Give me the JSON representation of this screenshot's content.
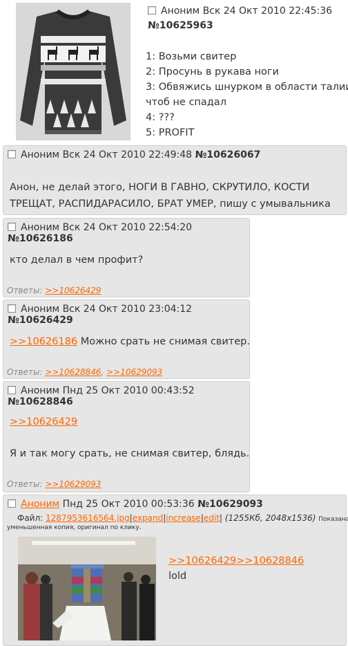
{
  "op": {
    "author": "Аноним",
    "date": "Вск 24 Окт 2010 22:45:36",
    "number": "№10625963",
    "lines": [
      "1: Возьми свитер",
      "2: Просунь в рукава ноги",
      "3: Обвяжись шнурком в области талии",
      "чтоб не спадал",
      "4: ???",
      "5: PROFIT"
    ]
  },
  "posts": [
    {
      "author": "Аноним",
      "date": "Вск 24 Окт 2010 22:49:48",
      "number": "№10626067",
      "text_line1": "Анон, не делай этого, НОГИ В ГАВНО, СКРУТИЛО, КОСТИ",
      "text_line2": "ТРЕЩАТ, РАСПИДАРАСИЛО, БРАТ УМЕР, пишу с умывальника"
    },
    {
      "author": "Аноним",
      "date": "Вск 24 Окт 2010 22:54:20",
      "number": "№10626186",
      "text": "кто делал в чем профит?",
      "answers_label": "Ответы:",
      "answers": [
        ">>10626429"
      ]
    },
    {
      "author": "Аноним",
      "date": "Вск 24 Окт 2010 23:04:12",
      "number": "№10626429",
      "quote": ">>10626186",
      "text": " Можно срать не снимая свитер.",
      "answers_label": "Ответы:",
      "answers": [
        ">>10628846",
        ">>10629093"
      ],
      "answers_sep": ","
    },
    {
      "author": "Аноним",
      "date": "Пнд 25 Окт 2010 00:43:52",
      "number": "№10628846",
      "quote": ">>10626429",
      "text": "Я и так могу срать, не снимая свитер, блядь.",
      "answers_label": "Ответы:",
      "answers": [
        ">>10629093"
      ]
    },
    {
      "author": "Аноним",
      "date": "Пнд 25 Окт 2010 00:53:36",
      "number": "№10629093",
      "file_label": "Файл:",
      "file_name": "1287953616564.jpg",
      "file_actions": [
        "expand",
        "increase",
        "edit"
      ],
      "file_info": "(1255Кб, 2048x1536)",
      "file_note_1": "Показана",
      "file_note_2": "уменьшенная копия, оригинал по клику.",
      "quote": ">>10626429>>10628846",
      "text": "lold"
    }
  ],
  "colors": {
    "link": "#ff6600",
    "reply_bg": "#e6e6e6",
    "reply_border": "#d0d0d0"
  }
}
